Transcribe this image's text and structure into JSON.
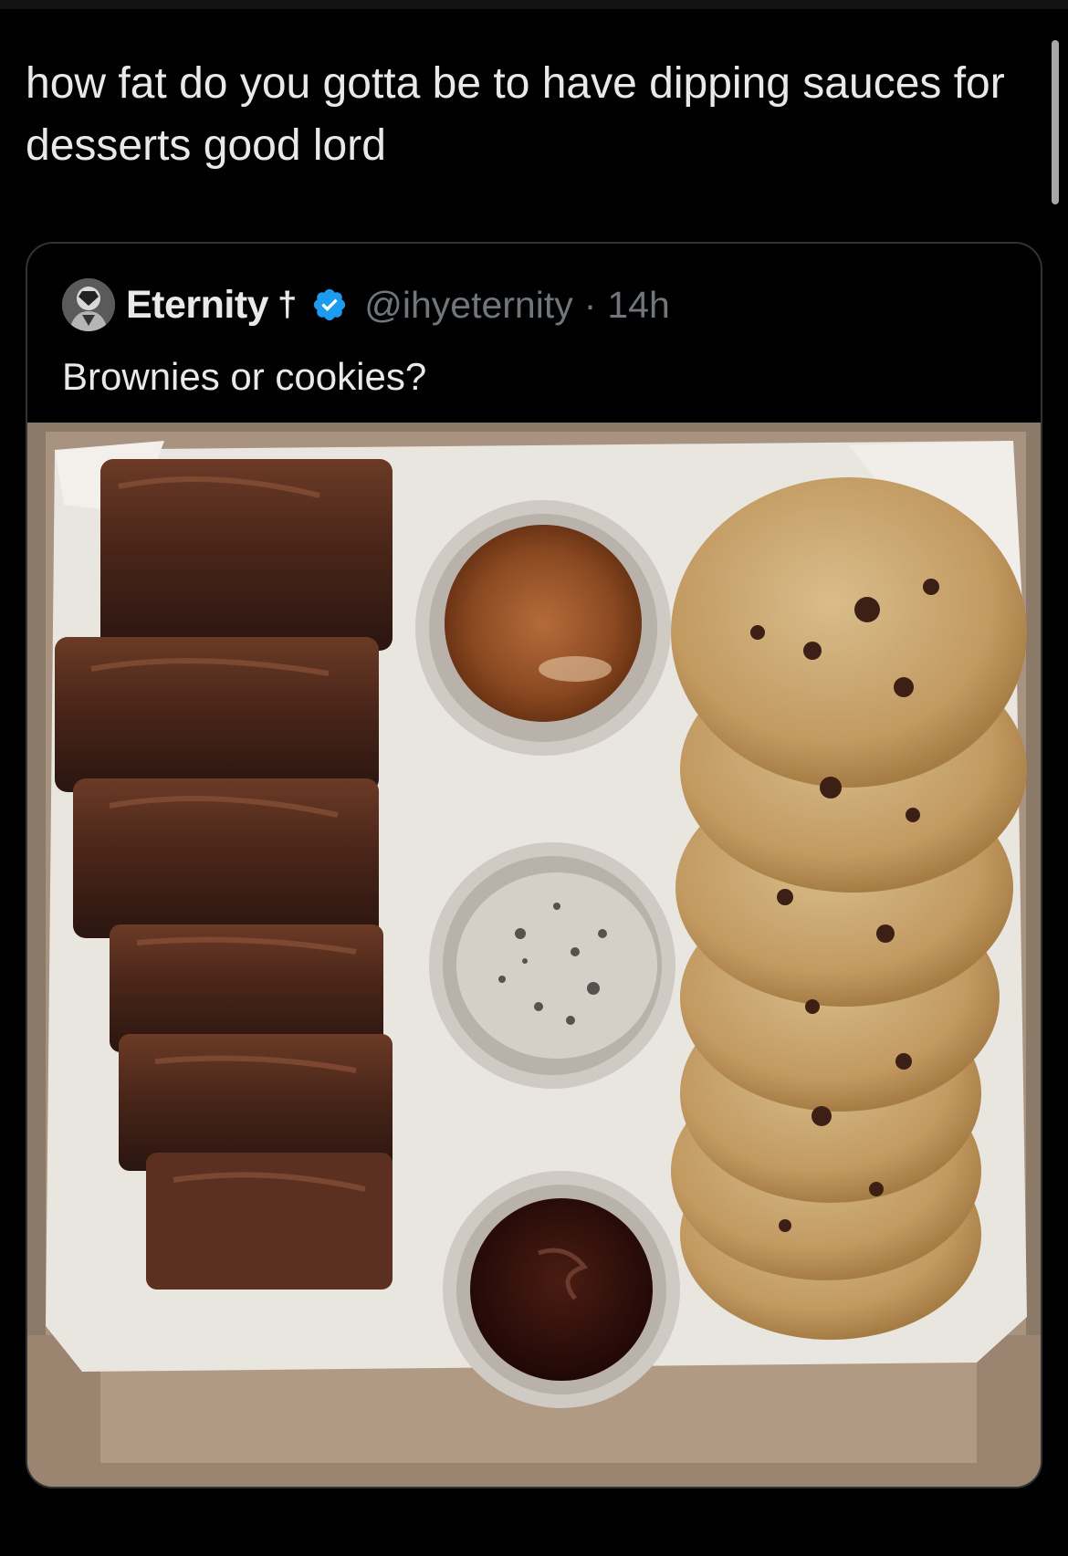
{
  "tweet": {
    "text": "how fat do you gotta be to have dipping sauces for desserts good lord"
  },
  "quoted": {
    "author_name": "Eternity",
    "author_suffix": "†",
    "handle": "@ihyeternity",
    "separator": "·",
    "time": "14h",
    "text": "Brownies or cookies?",
    "verified": true,
    "avatar_icon": "avatar-icon",
    "verified_icon": "verified-badge-icon"
  },
  "media": {
    "icon": "food-photo"
  },
  "colors": {
    "background": "#000000",
    "text": "#e7e9ea",
    "secondary_text": "#71767b",
    "border": "#2f3336",
    "verified_blue": "#1d9bf0"
  }
}
